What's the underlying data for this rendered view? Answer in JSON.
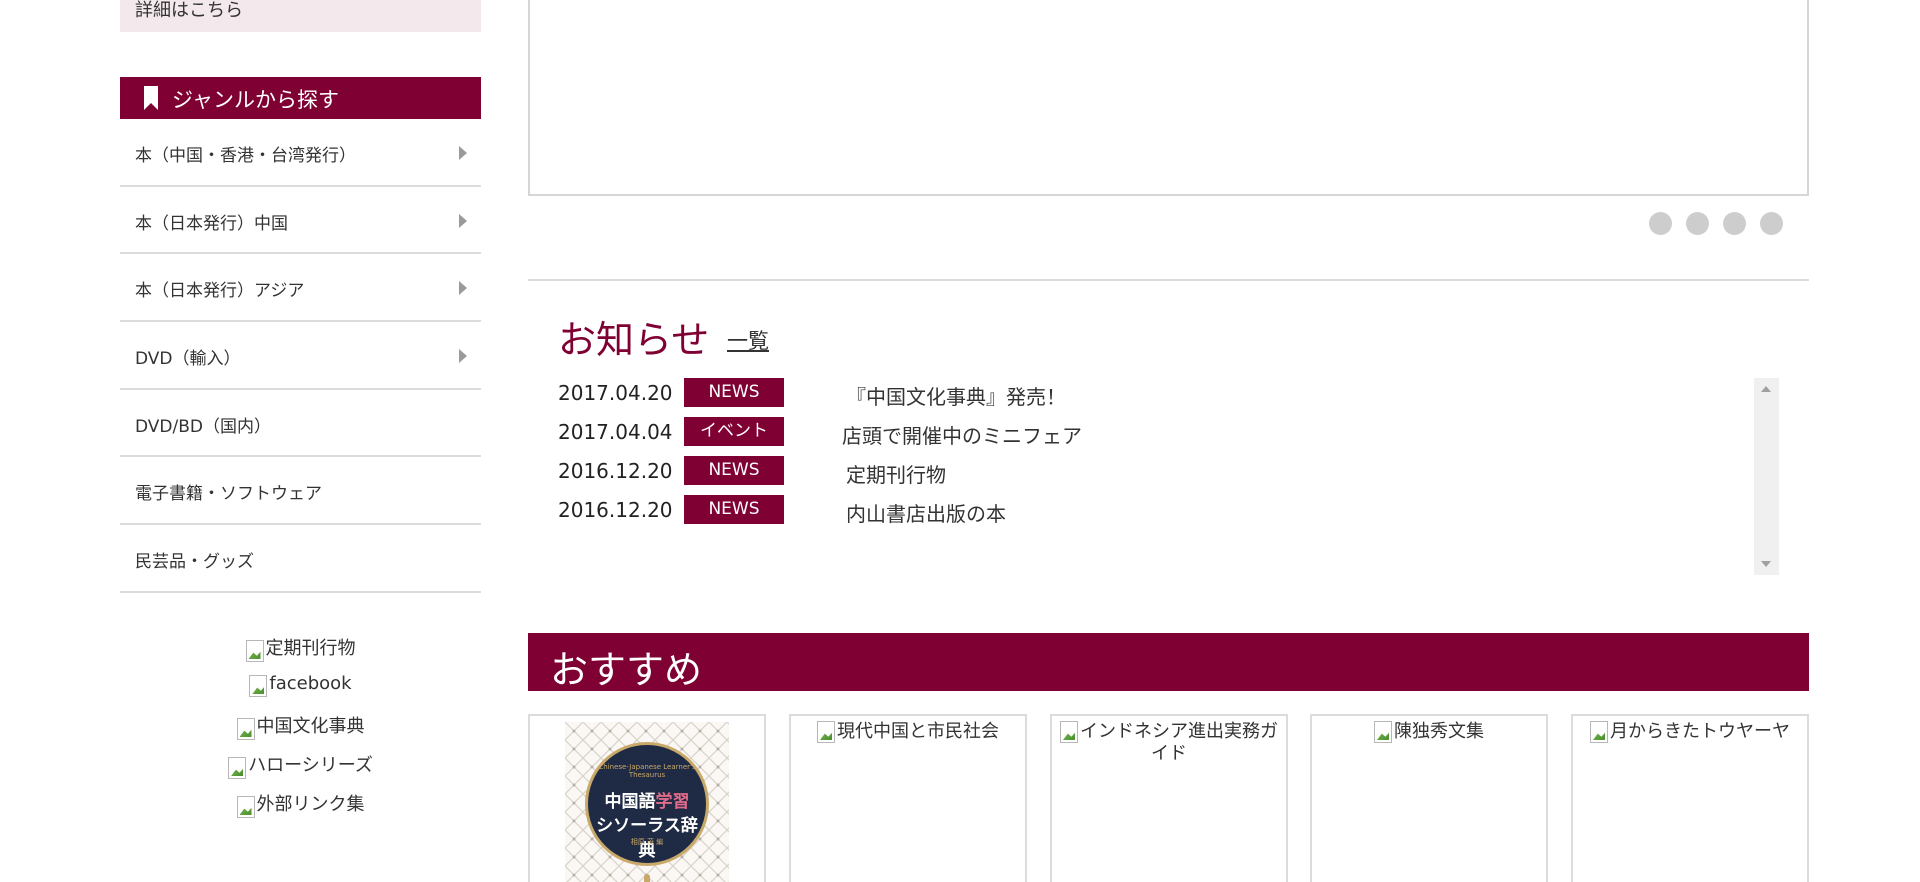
{
  "sidebar": {
    "detail_link": "詳細はこちら",
    "genre_title": "ジャンルから探す",
    "genres": [
      {
        "label": "本（中国・香港・台湾発行）",
        "has_sub": true
      },
      {
        "label": "本（日本発行）中国",
        "has_sub": true
      },
      {
        "label": "本（日本発行）アジア",
        "has_sub": true
      },
      {
        "label": "DVD（輸入）",
        "has_sub": true
      },
      {
        "label": "DVD/BD（国内）",
        "has_sub": false
      },
      {
        "label": "電子書籍・ソフトウェア",
        "has_sub": false
      },
      {
        "label": "民芸品・グッズ",
        "has_sub": false
      }
    ],
    "banners": [
      "定期刊行物",
      "facebook",
      "中国文化事典",
      "ハローシリーズ",
      "外部リンク集"
    ]
  },
  "slider": {
    "dot_count": 4
  },
  "news": {
    "title": "お知らせ",
    "more_link": "一覧",
    "items": [
      {
        "date": "2017.04.20",
        "tag": "NEWS",
        "text": "『中国文化事典』発売！"
      },
      {
        "date": "2017.04.04",
        "tag": "イベント",
        "text": "店頭で開催中のミニフェア"
      },
      {
        "date": "2016.12.20",
        "tag": "NEWS",
        "text": "定期刊行物"
      },
      {
        "date": "2016.12.20",
        "tag": "NEWS",
        "text": "内山書店出版の本"
      }
    ]
  },
  "recommend": {
    "title": "おすすめ",
    "first_book": {
      "title_line1_a": "中国語",
      "title_line1_b": "学習",
      "title_line2": "シソーラス辞典",
      "subtitle": "Chinese-Japanese Learner's Thesaurus",
      "author": "相原 茂 編"
    },
    "items": [
      "現代中国と市民社会",
      "インドネシア進出実務ガイド",
      "陳独秀文集",
      "月からきたトウヤーヤ"
    ]
  },
  "colors": {
    "brand": "#7f0033",
    "detail_bg": "#f3e8ec",
    "dot": "#cdcdcd"
  }
}
